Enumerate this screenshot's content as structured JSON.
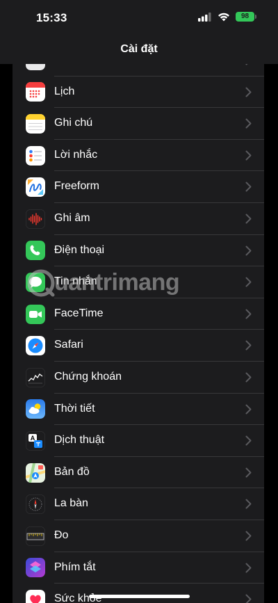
{
  "status_bar": {
    "time": "15:33",
    "battery": "98"
  },
  "nav": {
    "title": "Cài đặt"
  },
  "watermark": {
    "text": "uantrimang"
  },
  "rows": [
    {
      "label": "",
      "icon": "partial-app-icon"
    },
    {
      "label": "Lịch",
      "icon": "calendar-icon"
    },
    {
      "label": "Ghi chú",
      "icon": "notes-icon"
    },
    {
      "label": "Lời nhắc",
      "icon": "reminders-icon"
    },
    {
      "label": "Freeform",
      "icon": "freeform-icon"
    },
    {
      "label": "Ghi âm",
      "icon": "voice-memos-icon"
    },
    {
      "label": "Điện thoại",
      "icon": "phone-icon"
    },
    {
      "label": "Tin nhắn",
      "icon": "messages-icon"
    },
    {
      "label": "FaceTime",
      "icon": "facetime-icon"
    },
    {
      "label": "Safari",
      "icon": "safari-icon"
    },
    {
      "label": "Chứng khoán",
      "icon": "stocks-icon"
    },
    {
      "label": "Thời tiết",
      "icon": "weather-icon"
    },
    {
      "label": "Dịch thuật",
      "icon": "translate-icon"
    },
    {
      "label": "Bản đồ",
      "icon": "maps-icon"
    },
    {
      "label": "La bàn",
      "icon": "compass-icon"
    },
    {
      "label": "Đo",
      "icon": "measure-icon"
    },
    {
      "label": "Phím tắt",
      "icon": "shortcuts-icon"
    },
    {
      "label": "Sức khỏe",
      "icon": "health-icon"
    }
  ]
}
